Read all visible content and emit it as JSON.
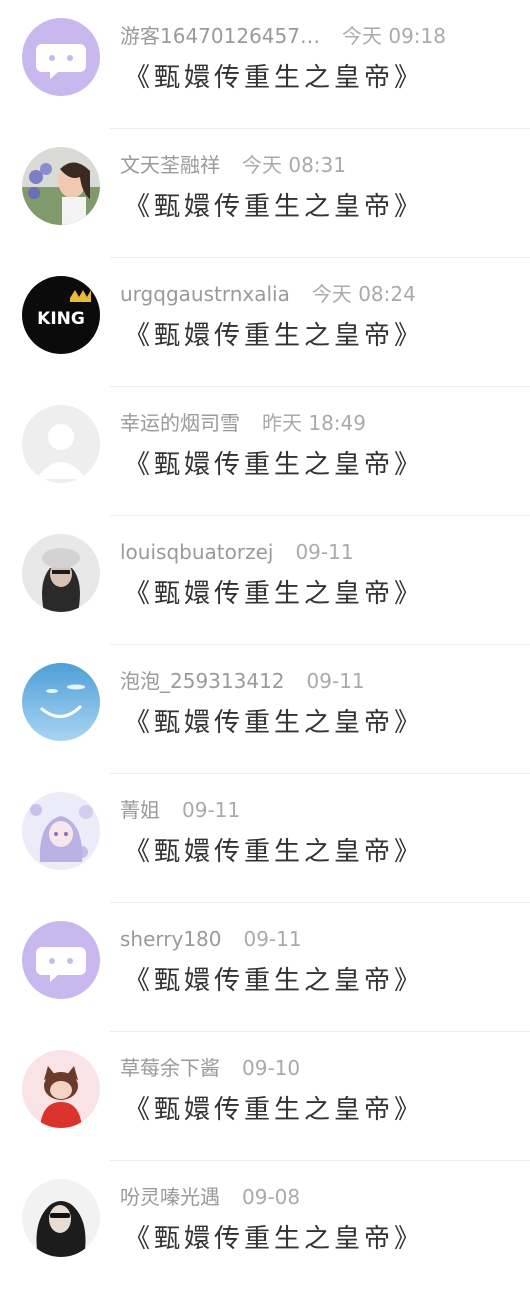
{
  "comments": [
    {
      "username": "游客16470126457…",
      "time": "今天 09:18",
      "message": "《甄嬛传重生之皇帝》",
      "avatar": "default-chat-bubble-avatar"
    },
    {
      "username": "文天荃融祥",
      "time": "今天 08:31",
      "message": "《甄嬛传重生之皇帝》",
      "avatar": "woman-with-flowers-avatar"
    },
    {
      "username": "urgqgaustrnxalia",
      "time": "今天 08:24",
      "message": "《甄嬛传重生之皇帝》",
      "avatar": "king-crown-avatar"
    },
    {
      "username": "幸运的烟司雪",
      "time": "昨天 18:49",
      "message": "《甄嬛传重生之皇帝》",
      "avatar": "placeholder-person-avatar"
    },
    {
      "username": "louisqbuatorzej",
      "time": "09-11",
      "message": "《甄嬛传重生之皇帝》",
      "avatar": "woman-in-hat-avatar"
    },
    {
      "username": "泡泡_259313412",
      "time": "09-11",
      "message": "《甄嬛传重生之皇帝》",
      "avatar": "blue-sky-smile-avatar"
    },
    {
      "username": "菁姐",
      "time": "09-11",
      "message": "《甄嬛传重生之皇帝》",
      "avatar": "anime-girl-avatar"
    },
    {
      "username": "sherry180",
      "time": "09-11",
      "message": "《甄嬛传重生之皇帝》",
      "avatar": "default-chat-bubble-avatar"
    },
    {
      "username": "草莓余下酱",
      "time": "09-10",
      "message": "《甄嬛传重生之皇帝》",
      "avatar": "fox-character-avatar"
    },
    {
      "username": "吩灵嗪光遇",
      "time": "09-08",
      "message": "《甄嬛传重生之皇帝》",
      "avatar": "woman-sunglasses-avatar"
    }
  ],
  "colors": {
    "default_avatar_bg": "#c9b8ee",
    "username_text": "#9a9a9a",
    "time_text": "#aaaaaa",
    "message_text": "#333333",
    "divider": "#ececec"
  }
}
